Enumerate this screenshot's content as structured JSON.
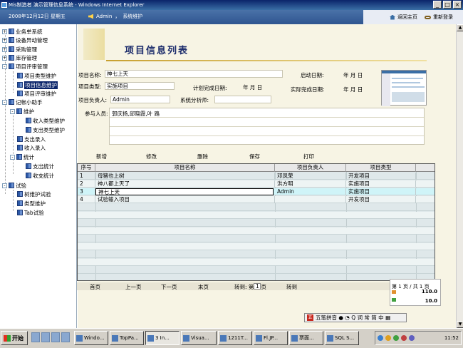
{
  "window": {
    "title": "Mis制造者  演示管理信息系统 - Windows Internet Explorer",
    "btn_min": "_",
    "btn_max": "□",
    "btn_close": "×"
  },
  "header": {
    "date": "2008年12月12日 星期五",
    "user": "Admin",
    "separator": "，",
    "module": "系统维护",
    "home": "返回主页",
    "relogin": "重新登录"
  },
  "sidebar": {
    "items": [
      {
        "label": "业务单系统"
      },
      {
        "label": "设备异动管理"
      },
      {
        "label": "采购管理"
      },
      {
        "label": "库存管理"
      },
      {
        "label": "项目评审管理"
      },
      {
        "label": "项目类型维护"
      },
      {
        "label": "项目信息维护"
      },
      {
        "label": "项目评审维护"
      },
      {
        "label": "记帐小助手"
      },
      {
        "label": "维护"
      },
      {
        "label": "收入类型维护"
      },
      {
        "label": "支出类型维护"
      },
      {
        "label": "支出录入"
      },
      {
        "label": "收入录入"
      },
      {
        "label": "统计"
      },
      {
        "label": "支出统计"
      },
      {
        "label": "收支统计"
      },
      {
        "label": "试验"
      },
      {
        "label": "树维护试验"
      },
      {
        "label": "类型维护"
      },
      {
        "label": "Tab试验"
      }
    ]
  },
  "page": {
    "title": "项目信息列表"
  },
  "form": {
    "name_label": "项目名称:",
    "name_value": "神七上天",
    "type_label": "项目类型:",
    "type_value": "实施项目",
    "manager_label": "项目负责人:",
    "manager_value": "Admin",
    "start_label": "启动日期:",
    "start_value": "年  月  日",
    "plan_label": "计划完成日期:",
    "plan_value": "年  月  日",
    "actual_label": "实际完成日期:",
    "actual_value": "年  月  日",
    "analyst_label": "系统分析师:",
    "analyst_value": "",
    "members_label": "参与人员:",
    "members_value": "郭庆扬,邱晓霞,叶 路"
  },
  "actions": {
    "new": "新增",
    "edit": "修改",
    "delete": "删除",
    "save": "保存",
    "print": "打印"
  },
  "grid": {
    "headers": [
      "序号",
      "项目名称",
      "项目负责人",
      "项目类型"
    ],
    "rows": [
      {
        "no": "1",
        "name": "母猪也上树",
        "manager": "邓凤荣",
        "type": "开发项目"
      },
      {
        "no": "2",
        "name": "神八都上天了",
        "manager": "洪方明",
        "type": "实施项目"
      },
      {
        "no": "3",
        "name": "神七上天",
        "manager": "Admin",
        "type": "实施项目"
      },
      {
        "no": "4",
        "name": "试验输入项目",
        "manager": "",
        "type": "开发项目"
      }
    ]
  },
  "pager": {
    "first": "首页",
    "prev": "上一页",
    "next": "下一页",
    "last": "末页",
    "goto_label": "转到: 第",
    "goto_value": "1",
    "goto_suffix": "页",
    "goto_btn": "转到"
  },
  "pageinfo": {
    "text": "第 1 页 / 共 1 页",
    "val1": "110.0",
    "val2": "10.0"
  },
  "ime": {
    "logo": "五",
    "text": "五笔拼音 ● ◔  Q 词 常 简 中 ▦"
  },
  "taskbar": {
    "start": "开始",
    "tasks": [
      "Windo...",
      "TopPa...",
      "3 In...",
      "Visua...",
      "1211T...",
      "Fl.JP...",
      "票面...",
      "SQL S..."
    ],
    "clock": "11:52"
  }
}
